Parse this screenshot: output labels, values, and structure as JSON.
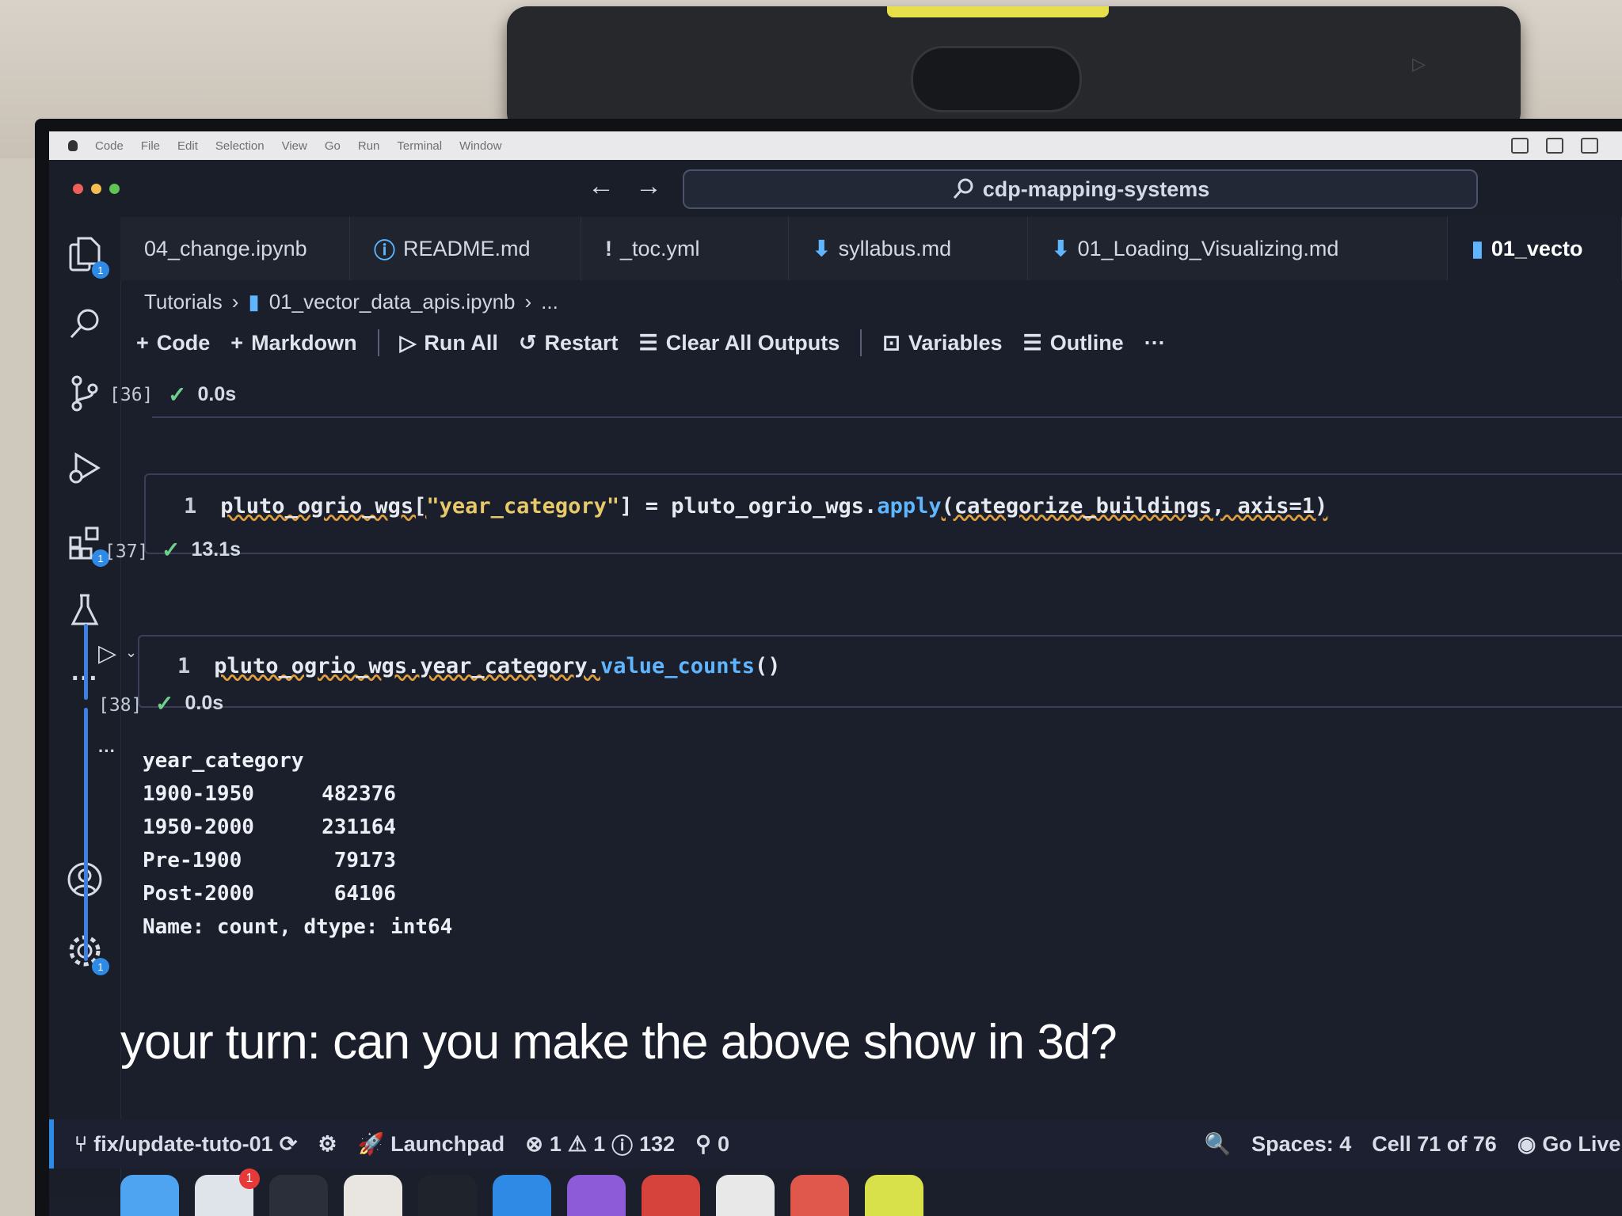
{
  "menubar": {
    "items": [
      "Code",
      "File",
      "Edit",
      "Selection",
      "View",
      "Go",
      "Run",
      "Terminal",
      "Window"
    ]
  },
  "titlebar": {
    "search_text": "cdp-mapping-systems"
  },
  "tabs": [
    {
      "label": "04_change.ipynb",
      "icon": ""
    },
    {
      "label": "README.md",
      "icon": "ⓘ"
    },
    {
      "label": "_toc.yml",
      "icon": "!"
    },
    {
      "label": "syllabus.md",
      "icon": "⬇"
    },
    {
      "label": "01_Loading_Visualizing.md",
      "icon": "⬇"
    },
    {
      "label": "01_vecto",
      "icon": "▮"
    }
  ],
  "breadcrumb": {
    "folder": "Tutorials",
    "file": "01_vector_data_apis.ipynb",
    "more": "..."
  },
  "toolbar": {
    "code": "Code",
    "markdown": "Markdown",
    "run_all": "Run All",
    "restart": "Restart",
    "clear_outputs": "Clear All Outputs",
    "variables": "Variables",
    "outline": "Outline",
    "more": "···"
  },
  "cells": [
    {
      "count": "[36]",
      "time": "0.0s"
    },
    {
      "count": "[37]",
      "time": "13.1s",
      "line_no": "1",
      "code_a": "pluto_ogrio_wgs[",
      "code_str": "\"year_category\"",
      "code_b": "] = pluto_ogrio_wgs.",
      "code_fn": "apply",
      "code_c": "(categorize_buildings, axis=1)"
    },
    {
      "count": "[38]",
      "time": "0.0s",
      "line_no": "1",
      "code_a": "pluto_ogrio_wgs.year_category.",
      "code_fn": "value_counts",
      "code_c": "()"
    }
  ],
  "output": {
    "ellipsis": "···",
    "header": "year_category",
    "rows": [
      {
        "key": "1900-1950",
        "value": "482376"
      },
      {
        "key": "1950-2000",
        "value": "231164"
      },
      {
        "key": "Pre-1900",
        "value": "79173"
      },
      {
        "key": "Post-2000",
        "value": "64106"
      }
    ],
    "footer": "Name: count, dtype: int64"
  },
  "overlay": {
    "caption": "your turn: can you make the above show in 3d?"
  },
  "statusbar": {
    "branch": "fix/update-tuto-01",
    "launchpad": "Launchpad",
    "errors": "1",
    "warnings": "1",
    "infos": "132",
    "ports": "0",
    "spaces": "Spaces: 4",
    "cell": "Cell 71 of 76",
    "go_live": "Go Live"
  },
  "activity_badges": {
    "explorer": "1",
    "extensions": "1",
    "settings": "1"
  },
  "dock": {
    "badge": "1"
  },
  "colors": {
    "accent": "#2f8ae6",
    "check": "#6fd08c",
    "string": "#e8c96a",
    "function": "#5fb6ff",
    "editor_bg": "#1b1f2b"
  }
}
